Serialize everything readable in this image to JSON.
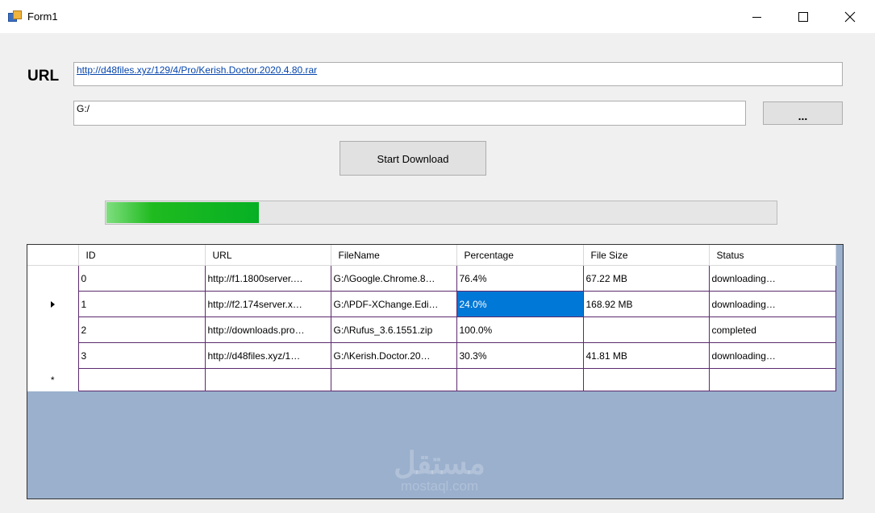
{
  "window": {
    "title": "Form1"
  },
  "form": {
    "url_label": "URL",
    "url_value": "http://d48files.xyz/129/4/Pro/Kerish.Doctor.2020.4.80.rar",
    "path_value": "G:/",
    "browse_label": "...",
    "start_label": "Start Download",
    "progress": 0.227
  },
  "grid": {
    "columns": [
      "ID",
      "URL",
      "FileName",
      "Percentage",
      "File Size",
      "Status"
    ],
    "rows": [
      {
        "id": "0",
        "url": "http://f1.1800server.…",
        "filename": "G:/\\Google.Chrome.8…",
        "percentage": "76.4%",
        "size": "67.22 MB",
        "status": "downloading…"
      },
      {
        "id": "1",
        "url": "http://f2.174server.x…",
        "filename": "G:/\\PDF-XChange.Edi…",
        "percentage": "24.0%",
        "size": "168.92 MB",
        "status": "downloading…"
      },
      {
        "id": "2",
        "url": "http://downloads.pro…",
        "filename": "G:/\\Rufus_3.6.1551.zip",
        "percentage": "100.0%",
        "size": "",
        "status": "completed"
      },
      {
        "id": "3",
        "url": "http://d48files.xyz/1…",
        "filename": "G:/\\Kerish.Doctor.20…",
        "percentage": "30.3%",
        "size": "41.81 MB",
        "status": "downloading…"
      }
    ],
    "new_row_marker": "*"
  },
  "watermark": {
    "arabic": "مستقل",
    "latin": "mostaql.com"
  },
  "colors": {
    "selection": "#0078d7",
    "progress_fill": "#06b025",
    "grid_background": "#9ab0cd",
    "grid_lines": "#5c2a6e"
  }
}
